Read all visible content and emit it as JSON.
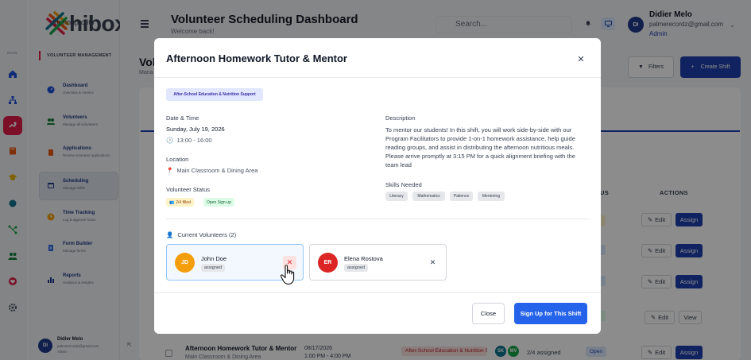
{
  "brand": {
    "word": "hibox",
    "sub": "for nonprofits"
  },
  "rail": {
    "main_label": "MAIN"
  },
  "sidebar": {
    "section": "VOLUNTEER MANAGEMENT",
    "items": [
      {
        "title": "Dashboard",
        "sub": "Overview & metrics"
      },
      {
        "title": "Volunteers",
        "sub": "Manage all volunteers"
      },
      {
        "title": "Applications",
        "sub": "Review volunteer applications"
      },
      {
        "title": "Scheduling",
        "sub": "Manage shifts"
      },
      {
        "title": "Time Tracking",
        "sub": "Log & approve hours"
      },
      {
        "title": "Form Builder",
        "sub": "Manage forms"
      },
      {
        "title": "Reports",
        "sub": "Analytics & insights"
      }
    ],
    "user": {
      "name": "Didier Melo",
      "email": "palmerecordz@gmail.com",
      "role": "Admin",
      "initials": "DI"
    }
  },
  "header": {
    "title": "Volunteer Scheduling Dashboard",
    "subtitle": "Welcome back!",
    "search_placeholder": "Search...",
    "user": {
      "initials": "DI",
      "name": "Didier Melo",
      "email": "palmerecordz@gmail.com",
      "role": "Admin"
    }
  },
  "background": {
    "title_fragment": "Vol",
    "sub_fragment": "Mana",
    "filters_label": "Filters",
    "create_label": "Create Shift",
    "col_status_fragment": "US",
    "col_actions": "ACTIONS",
    "edit_label": "Edit",
    "assign_label": "Assign",
    "view_label": "View",
    "last_row": {
      "name": "Afternoon Homework Tutor & Mentor",
      "location": "Main Classroom & Dining Area",
      "date": "08/17/2026",
      "time": "1:00 PM - 4:00 PM",
      "category": "After-School Education & Nutrition Support",
      "avatars": [
        "SK",
        "MV"
      ],
      "count": "2/4 assigned",
      "status": "Open"
    }
  },
  "modal": {
    "title": "Afternoon Homework Tutor & Mentor",
    "category": "After-School Education & Nutrition Support",
    "date_time_label": "Date & Time",
    "date": "Sunday, July 19, 2026",
    "time": "13:00 - 16:00",
    "location_label": "Location",
    "location": "Main Classroom & Dining Area",
    "status_label": "Volunteer Status",
    "filled": "2/4 filled",
    "signup_status": "Open Sign-up",
    "description_label": "Description",
    "description": "To mentor our students! In this shift, you will work side-by-side with our Program Facilitators to provide 1-on-1 homework assistance, help guide reading groups, and assist in distributing the afternoon nutritious meals. Please arrive promptly at 3:15 PM for a quick alignment briefing with the team lead",
    "skills_label": "Skills Needed",
    "skills": [
      "Literacy",
      "Mathematics",
      "Patience",
      "Mentoring"
    ],
    "current_label": "Current Volunteers (2)",
    "volunteers": [
      {
        "initials": "JD",
        "name": "John Doe",
        "status": "assigned",
        "color": "#f59e0b"
      },
      {
        "initials": "ER",
        "name": "Elena Rostova",
        "status": "assigned",
        "color": "#dc2626"
      }
    ],
    "close_label": "Close",
    "signup_label": "Sign Up for This Shift"
  },
  "colors": {
    "primary": "#1e40af",
    "accent": "#e11d48",
    "cta": "#2563eb"
  }
}
